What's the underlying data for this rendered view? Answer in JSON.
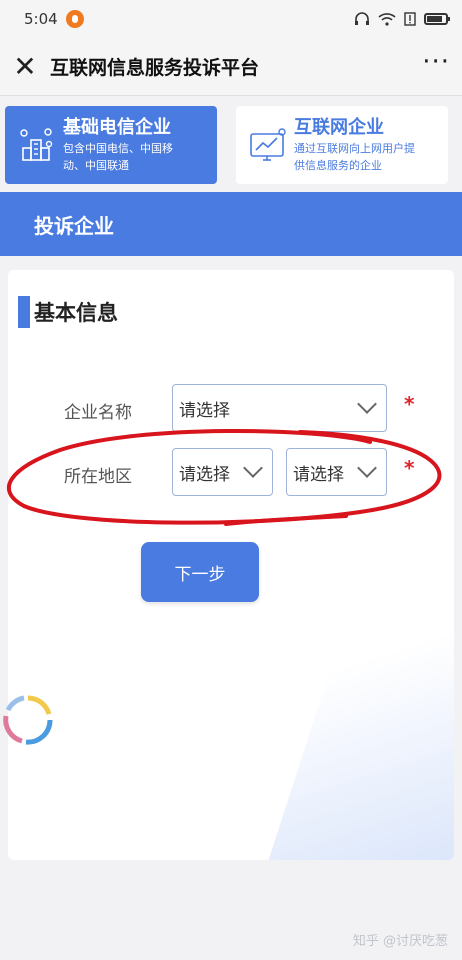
{
  "status": {
    "time": "5:04"
  },
  "nav": {
    "title": "互联网信息服务投诉平台"
  },
  "categories": [
    {
      "title": "基础电信企业",
      "desc_line1": "包含中国电信、中国移",
      "desc_line2": "动、中国联通",
      "icon": "telecom-building-icon",
      "active": true
    },
    {
      "title": "互联网企业",
      "desc_line1": "通过互联网向上网用户提",
      "desc_line2": "供信息服务的企业",
      "icon": "monitor-chart-icon",
      "active": false
    }
  ],
  "section": {
    "title": "投诉企业"
  },
  "form": {
    "heading": "基本信息",
    "company_label": "企业名称",
    "company_value": "请选择",
    "region_label": "所在地区",
    "province_value": "请选择",
    "city_value": "请选择",
    "required_mark": "*",
    "next_label": "下一步"
  },
  "watermark": "知乎 @讨厌吃葱",
  "colors": {
    "accent": "#4a7be0",
    "required": "#e0242a",
    "annotation": "#d8141c"
  }
}
